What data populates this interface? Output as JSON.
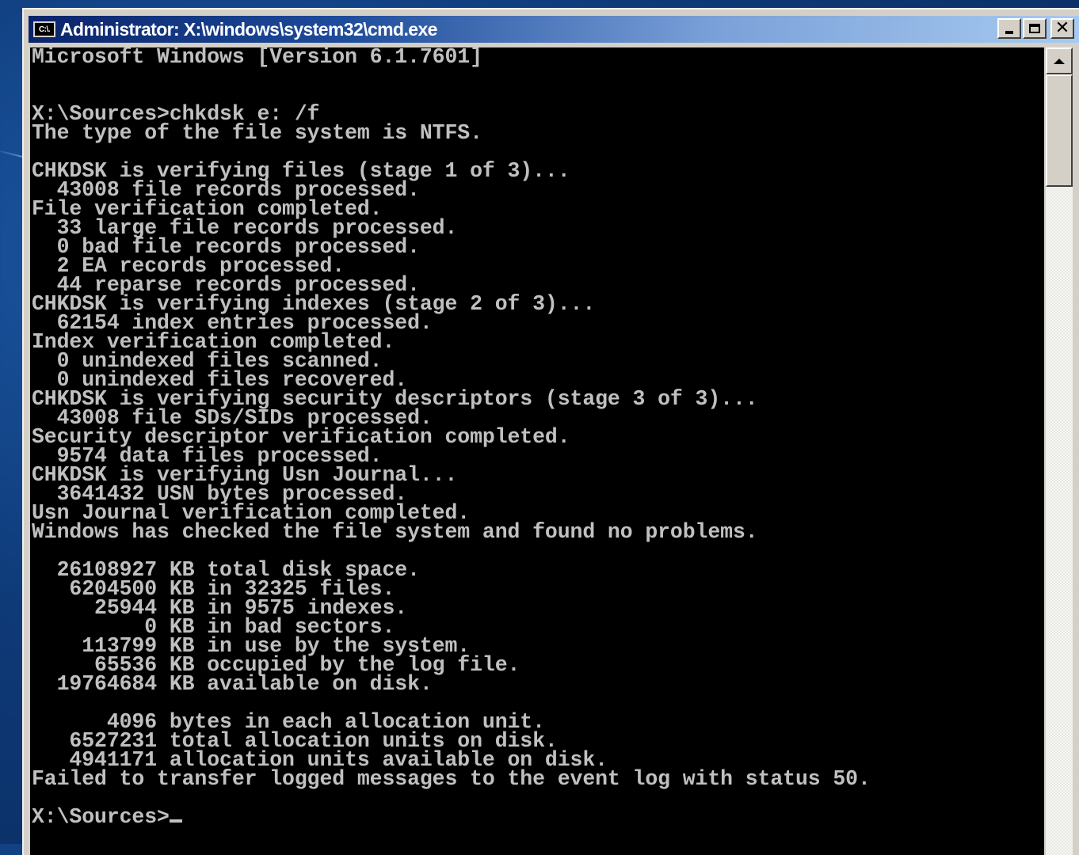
{
  "window": {
    "title": "Administrator: X:\\windows\\system32\\cmd.exe",
    "app_icon_text": "C:\\.",
    "buttons": {
      "minimize": "minimize",
      "maximize": "maximize",
      "close": "close"
    }
  },
  "console": {
    "lines": [
      "Microsoft Windows [Version 6.1.7601]",
      "",
      "",
      "X:\\Sources>chkdsk e: /f",
      "The type of the file system is NTFS.",
      "",
      "CHKDSK is verifying files (stage 1 of 3)...",
      "  43008 file records processed.",
      "File verification completed.",
      "  33 large file records processed.",
      "  0 bad file records processed.",
      "  2 EA records processed.",
      "  44 reparse records processed.",
      "CHKDSK is verifying indexes (stage 2 of 3)...",
      "  62154 index entries processed.",
      "Index verification completed.",
      "  0 unindexed files scanned.",
      "  0 unindexed files recovered.",
      "CHKDSK is verifying security descriptors (stage 3 of 3)...",
      "  43008 file SDs/SIDs processed.",
      "Security descriptor verification completed.",
      "  9574 data files processed.",
      "CHKDSK is verifying Usn Journal...",
      "  3641432 USN bytes processed.",
      "Usn Journal verification completed.",
      "Windows has checked the file system and found no problems.",
      "",
      "  26108927 KB total disk space.",
      "   6204500 KB in 32325 files.",
      "     25944 KB in 9575 indexes.",
      "         0 KB in bad sectors.",
      "    113799 KB in use by the system.",
      "     65536 KB occupied by the log file.",
      "  19764684 KB available on disk.",
      "",
      "      4096 bytes in each allocation unit.",
      "   6527231 total allocation units on disk.",
      "   4941171 allocation units available on disk.",
      "Failed to transfer logged messages to the event log with status 50.",
      ""
    ],
    "prompt": "X:\\Sources>"
  }
}
